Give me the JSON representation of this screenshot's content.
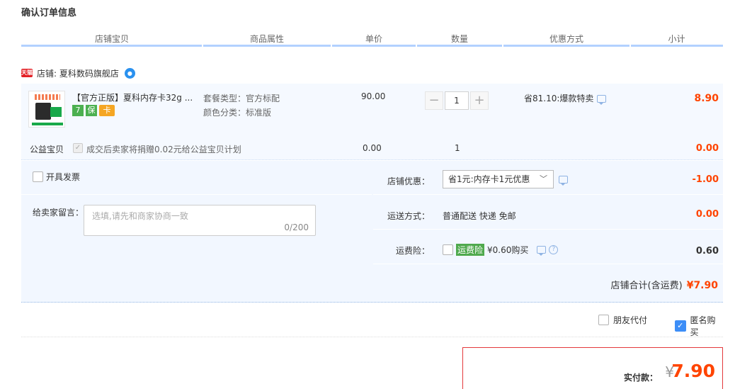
{
  "page_title": "确认订单信息",
  "columns": [
    "店铺宝贝",
    "商品属性",
    "单价",
    "数量",
    "优惠方式",
    "小计"
  ],
  "shop": {
    "badge": "天猫",
    "label": "店铺: 夏科数码旗舰店"
  },
  "item": {
    "title": "【官方正版】夏科内存卡32g ...",
    "attr_package": "套餐类型：官方标配",
    "attr_color": "颜色分类：标准版",
    "unit_price": "90.00",
    "quantity": "1",
    "qty_minus": "−",
    "qty_plus": "+",
    "discount": "省81.10:爆款特卖",
    "subtotal": "8.90",
    "service_icons": [
      "7",
      "保",
      "卡"
    ]
  },
  "charity": {
    "label": "公益宝贝",
    "text": "成交后卖家将捐赠0.02元给公益宝贝计划",
    "price": "0.00",
    "qty": "1",
    "subtotal": "0.00"
  },
  "invoice": {
    "label": "开具发票"
  },
  "note": {
    "label": "给卖家留言：",
    "placeholder": "选填,请先和商家协商一致",
    "counter": "0/200"
  },
  "shop_discount": {
    "label": "店铺优惠：",
    "selected": "省1元:内存卡1元优惠",
    "value": "-1.00"
  },
  "shipping": {
    "label": "运送方式：",
    "text": "普通配送 快递 免邮",
    "value": "0.00"
  },
  "insurance": {
    "label": "运费险：",
    "tag": "运费险",
    "text": "¥0.60购买",
    "value": "0.60"
  },
  "shop_total": {
    "label": "店铺合计(含运费)",
    "value": "¥7.90"
  },
  "extras": {
    "friend_pay": "朋友代付",
    "anonymous": "匿名购买"
  },
  "payment": {
    "label": "实付款：",
    "currency": "¥",
    "value": "7.90"
  },
  "colors": {
    "accent": "#ff4400",
    "header_border": "#b2d1ff",
    "row_bg": "#f2f7ff"
  }
}
